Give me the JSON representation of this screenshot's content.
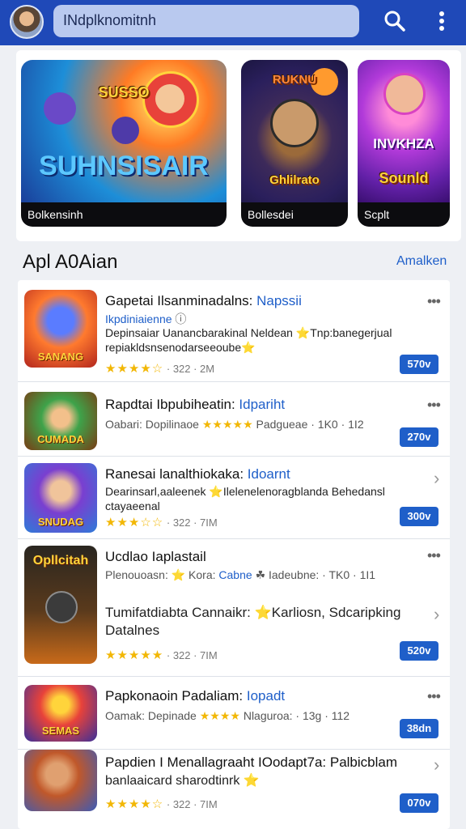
{
  "header": {
    "search_text": "INdplknomitnh",
    "search_icon": "search-icon",
    "more_icon": "more-vert-icon"
  },
  "banners": [
    {
      "art_title": "SUHNSISAIR",
      "art_sub": "SUSSO",
      "caption": "Bolkensinh"
    },
    {
      "art_title": "Ghlilrato",
      "art_sub": "RUKNU",
      "caption": "Bollesdei"
    },
    {
      "art_title": "Sounld",
      "art_sub": "INVKHZA",
      "caption": "Scplt"
    }
  ],
  "section": {
    "title": "Apl A0Aian",
    "link": "Amalken"
  },
  "items": [
    {
      "thumb_label": "SANANG",
      "title": "Gapetai Ilsanminadalns:",
      "title_accent": "Napssii",
      "sub_blue": "Ikpdiniaienne",
      "sub_rest": "ⓘ",
      "desc": "Depinsaiar Uanancbarakinal Neldean ⭐Tnp:banegerjual repiakldsnsenodarseeoube⭐",
      "stars": "★★★★☆",
      "meta": "· 322 · 2M",
      "price": "570v",
      "trailing": "dots"
    },
    {
      "thumb_label": "CUMADA",
      "title": "Rapdtai Ibpubiheatin:",
      "title_accent": "Idpariht",
      "sub_pre": "Oabari: Dopilinaoe",
      "sub_stars": "★★★★★",
      "sub_post": "Padgueae · 1K0 · 1I2",
      "price": "270v",
      "trailing": "dots"
    },
    {
      "thumb_label": "SNUDAG",
      "title": "Ranesai lanalthiokaka:",
      "title_accent": "Idoarnt",
      "desc": "Dearinsarl,aaleenek ⭐Ilelenelenoragblanda Behedansl ctayaeenal",
      "stars": "★★★☆☆",
      "meta": "· 322 · 7IM",
      "price": "300v",
      "trailing": "chevron"
    },
    {
      "thumb_label": "Opllcitah",
      "title": "Ucdlao Iaplastail",
      "sub_pre": "Plenouoasn: ⭐ Kora:",
      "sub_blue": "Cabne",
      "sub_post": "☘ Iadeubne: · TK0 · 1I1",
      "desc": "Tumifatdiabta Cannaikr: ⭐Karliosn, Sdcaripking Datalnes",
      "stars": "★★★★★",
      "meta": "· 322 · 7IM",
      "price": "520v",
      "trailing": "dots-chevron"
    },
    {
      "thumb_label": "SEMAS",
      "title": "Papkonaoin Padaliam:",
      "title_accent": "Iopadt",
      "sub_pre": "Oamak: Depinade",
      "sub_stars": "★★★★",
      "sub_post": "Nlaguroa: · 13g · 112",
      "price": "38dn",
      "trailing": "dots"
    },
    {
      "thumb_label": "",
      "title": "Papdien I Menallagraaht IOodapt7a: Palbicblam",
      "desc": "banlaaicard sharodtinrk ⭐",
      "stars": "★★★★☆",
      "meta": "· 322 · 7IM",
      "price": "070v",
      "trailing": "chevron"
    }
  ],
  "colors": {
    "topbar": "#1f49b8",
    "accent": "#1f5fc9",
    "star": "#f2b705"
  }
}
